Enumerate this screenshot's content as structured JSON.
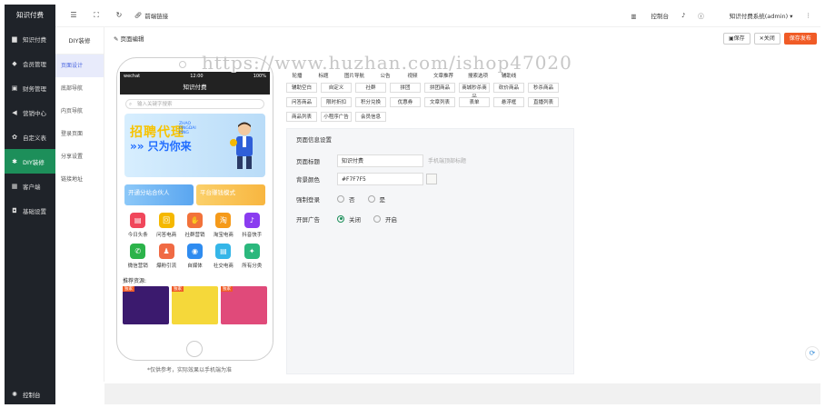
{
  "sidebar": {
    "title": "知识付费",
    "items": [
      {
        "icon": "book-icon",
        "label": "知识付费"
      },
      {
        "icon": "member-icon",
        "label": "会员管理"
      },
      {
        "icon": "finance-icon",
        "label": "财务管理"
      },
      {
        "icon": "megaphone-icon",
        "label": "营销中心"
      },
      {
        "icon": "gear-icon",
        "label": "自定义表"
      },
      {
        "icon": "diy-icon",
        "label": "DIY装修"
      },
      {
        "icon": "grid-icon",
        "label": "客户端"
      },
      {
        "icon": "settings-icon",
        "label": "基础设置"
      }
    ],
    "active_index": 5,
    "bottom": "控制台"
  },
  "subnav": {
    "title": "DIY装修",
    "items": [
      "页面设计",
      "底部导航",
      "内页导航",
      "登录页面",
      "分享设置",
      "链接地址"
    ],
    "active_index": 0
  },
  "topbar": {
    "link_label": "前端链接",
    "console_label": "控制台",
    "user_label": "知识付费系统(admin)"
  },
  "page": {
    "crumb": "页面编辑",
    "save": "保存",
    "close": "关闭",
    "publish": "保存发布"
  },
  "watermark": "https://www.huzhan.com/ishop47020",
  "phone": {
    "status_left": "wechat",
    "time": "12:00",
    "battery": "100%",
    "app_title": "知识付费",
    "search_placeholder": "输入关键字搜索",
    "banner_line1": "招聘代理",
    "banner_line2": "»» 只为你来",
    "banner_small": "ZHAO PINGDAI PING",
    "promo": [
      "开通分站合伙人",
      "平台赚钱模式"
    ],
    "grid": [
      {
        "label": "今日头条",
        "color": "#f0475b"
      },
      {
        "label": "问答电商",
        "color": "#f5b800"
      },
      {
        "label": "社群营销",
        "color": "#f2723a"
      },
      {
        "label": "淘宝电商",
        "color": "#f59a1a"
      },
      {
        "label": "抖音快手",
        "color": "#8a3cf0"
      },
      {
        "label": "微信营销",
        "color": "#2cb34a"
      },
      {
        "label": "爆粉引流",
        "color": "#f06a44"
      },
      {
        "label": "自媒体",
        "color": "#2f8cf0"
      },
      {
        "label": "社交电商",
        "color": "#35b6e8"
      },
      {
        "label": "所有分类",
        "color": "#2bb87d"
      }
    ],
    "rec_title": "推荐资源:",
    "rec_tags": [
      "独家",
      "独家",
      "独家"
    ],
    "note": "*仅供参考，实际效果以手机端为准"
  },
  "components": [
    "轮播",
    "标题",
    "图片导航",
    "公告",
    "视频",
    "文章推荐",
    "搜索选项",
    "辅助线",
    "辅助空白",
    "自定义",
    "社群",
    "拼团",
    "拼团商品",
    "商城秒杀商品",
    "砍价商品",
    "秒杀商品",
    "问答商品",
    "限时折扣",
    "积分兑换",
    "优惠券",
    "文章列表",
    "表单",
    "悬浮框",
    "直播列表",
    "商品列表",
    "小程序广告",
    "会员信息"
  ],
  "form": {
    "title": "页面信息设置",
    "page_title_label": "页面标题",
    "page_title_value": "知识付费",
    "page_title_hint": "手机端顶部标题",
    "bg_label": "背景颜色",
    "bg_value": "#F7F7F5",
    "bg_color": "#F7F7F5",
    "login_label": "强制登录",
    "login_options": [
      "否",
      "是"
    ],
    "login_selected": 0,
    "ad_label": "开屏广告",
    "ad_options": [
      "关闭",
      "开启"
    ],
    "ad_selected": 0
  }
}
